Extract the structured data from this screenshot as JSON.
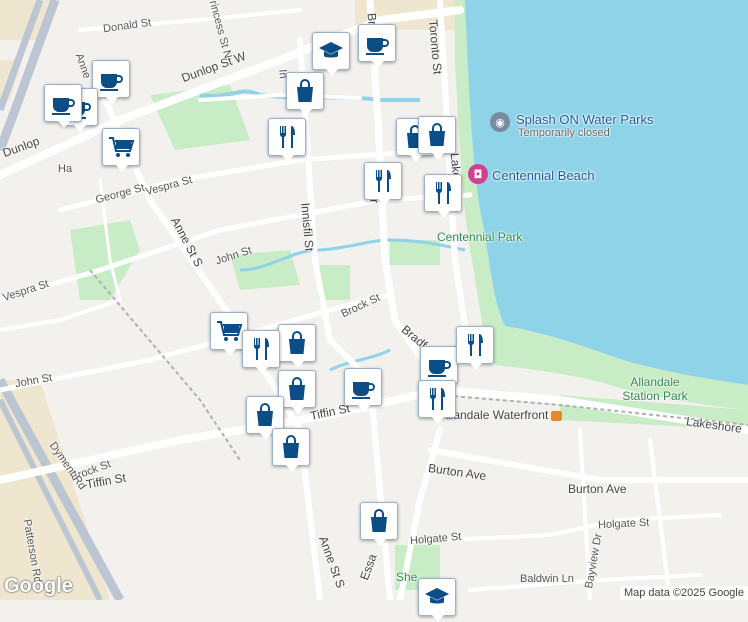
{
  "map": {
    "attribution": "Map data ©2025 Google",
    "logo": "Google",
    "colors": {
      "water": "#8fd3e8",
      "park": "#c8ecc5",
      "road": "#ffffff",
      "highway": "#bcc6d2",
      "land": "#f2f1ee",
      "marker": "#0b4d87"
    }
  },
  "streets": {
    "donald": "Donald St",
    "dunlop_w": "Dunlop St W",
    "dunlop": "Dunlop",
    "anne_n": "Anne",
    "vespra1": "Vespra St",
    "vespra2": "Vespra St",
    "george": "George St",
    "john1": "John St",
    "john2": "John St",
    "anne_s": "Anne St S",
    "anne_s2": "Anne St S",
    "innisfil": "Innisfil St",
    "innisfil_n": "In",
    "princess": "Princess St N",
    "brock1": "Brock St",
    "brock2": "Brock St",
    "bradford1": "Br",
    "bradford2": "Bradf",
    "toronto": "Toronto St",
    "lakeshore1": "Lakes",
    "lakeshore2": "Lakeshore",
    "tiffin1": "Tiffin St",
    "tiffin2": "Tiffin St",
    "dyment": "Dyment Rd",
    "patterson": "Patterson Rd",
    "essa": "Essa",
    "burton1": "Burton Ave",
    "burton2": "Burton Ave",
    "holgate1": "Holgate St",
    "holgate2": "Holgate St",
    "baldwin": "Baldwin Ln",
    "bayview": "Bayview Dr",
    "waterfront": "Allandale Waterfront",
    "ha": "Ha",
    "br_st": "Br",
    "sh": "She",
    "sh2": "Park"
  },
  "places": {
    "splash": {
      "name": "Splash ON Water Parks",
      "status": "Temporarily closed"
    },
    "beach": {
      "name": "Centennial Beach"
    },
    "park": {
      "name": "Centennial Park"
    },
    "allandale_park": {
      "name": "Allandale Station Park"
    }
  },
  "markers": [
    {
      "type": "cafe",
      "icon": "coffee-cup-icon"
    },
    {
      "type": "cafe",
      "icon": "coffee-cup-icon"
    },
    {
      "type": "cafe",
      "icon": "coffee-cup-icon"
    },
    {
      "type": "cafe",
      "icon": "coffee-cup-icon"
    },
    {
      "type": "school",
      "icon": "graduation-cap-icon"
    },
    {
      "type": "shopping",
      "icon": "shopping-bag-icon"
    },
    {
      "type": "shopping",
      "icon": "shopping-bag-icon"
    },
    {
      "type": "shopping",
      "icon": "shopping-bag-icon"
    },
    {
      "type": "shopping",
      "icon": "shopping-bag-icon"
    },
    {
      "type": "shopping",
      "icon": "shopping-bag-icon"
    },
    {
      "type": "shopping",
      "icon": "shopping-bag-icon"
    },
    {
      "type": "shopping",
      "icon": "shopping-bag-icon"
    },
    {
      "type": "shopping",
      "icon": "shopping-bag-icon"
    },
    {
      "type": "grocery",
      "icon": "shopping-cart-icon"
    },
    {
      "type": "grocery",
      "icon": "shopping-cart-icon"
    },
    {
      "type": "restaurant",
      "icon": "fork-knife-icon"
    },
    {
      "type": "restaurant",
      "icon": "fork-knife-icon"
    },
    {
      "type": "restaurant",
      "icon": "fork-knife-icon"
    },
    {
      "type": "restaurant",
      "icon": "fork-knife-icon"
    },
    {
      "type": "restaurant",
      "icon": "fork-knife-icon"
    },
    {
      "type": "restaurant",
      "icon": "fork-knife-icon"
    },
    {
      "type": "cafe",
      "icon": "coffee-cup-icon"
    },
    {
      "type": "cafe",
      "icon": "coffee-cup-icon"
    },
    {
      "type": "school",
      "icon": "graduation-cap-icon"
    }
  ]
}
